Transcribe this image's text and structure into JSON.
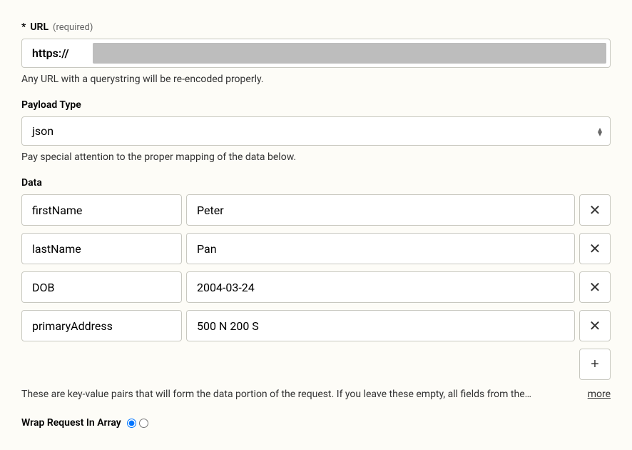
{
  "url": {
    "required_mark": "*",
    "label": "URL",
    "hint": "(required)",
    "value": "https://",
    "help": "Any URL with a querystring will be re-encoded properly."
  },
  "payloadType": {
    "label": "Payload Type",
    "value": "json",
    "help": "Pay special attention to the proper mapping of the data below."
  },
  "data": {
    "label": "Data",
    "rows": [
      {
        "key": "firstName",
        "value": "Peter"
      },
      {
        "key": "lastName",
        "value": "Pan"
      },
      {
        "key": "DOB",
        "value": "2004-03-24"
      },
      {
        "key": "primaryAddress",
        "value": "500 N 200 S"
      }
    ],
    "help": "These are key-value pairs that will form the data portion of the request. If you leave these empty, all fields from the…",
    "more": "more"
  },
  "wrap": {
    "label": "Wrap Request In Array"
  }
}
